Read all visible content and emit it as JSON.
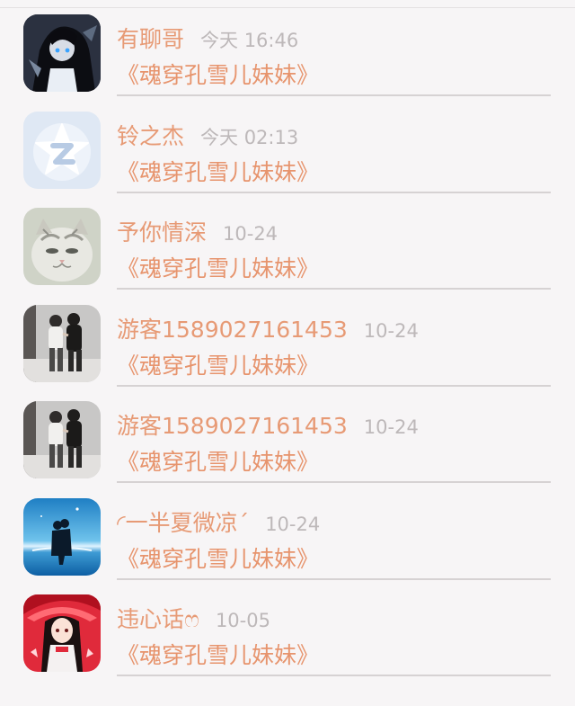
{
  "chats": [
    {
      "name": "有聊哥",
      "time": "今天 16:46",
      "message": "《魂穿孔雪儿妹妹》",
      "avatar_icon": "anime-character-avatar"
    },
    {
      "name": "铃之杰",
      "time": "今天 02:13",
      "message": "《魂穿孔雪儿妹妹》",
      "avatar_icon": "qq-default-avatar"
    },
    {
      "name": "予你情深",
      "time": "10-24",
      "message": "《魂穿孔雪儿妹妹》",
      "avatar_icon": "cat-avatar"
    },
    {
      "name": "游客1589027161453",
      "time": "10-24",
      "message": "《魂穿孔雪儿妹妹》",
      "avatar_icon": "couple-photo-avatar"
    },
    {
      "name": "游客1589027161453",
      "time": "10-24",
      "message": "《魂穿孔雪儿妹妹》",
      "avatar_icon": "couple-photo-avatar"
    },
    {
      "name": "◜一半夏微凉ˊ",
      "time": "10-24",
      "message": "《魂穿孔雪儿妹妹》",
      "avatar_icon": "couple-sea-avatar"
    },
    {
      "name": "违心话ෆ",
      "time": "10-05",
      "message": "《魂穿孔雪儿妹妹》",
      "avatar_icon": "anime-girl-avatar"
    }
  ],
  "colors": {
    "name_color": "#e79a75",
    "message_color": "#e7946d",
    "time_color": "#bdb8b9",
    "background": "#f7f5f6"
  }
}
